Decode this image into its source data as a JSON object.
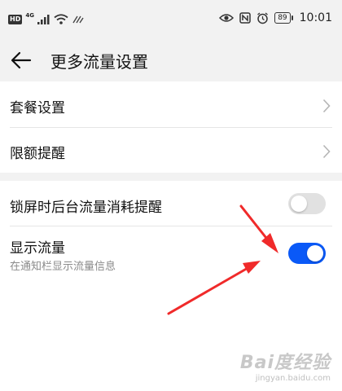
{
  "status_bar": {
    "hd_badge": "HD",
    "network_tag": "4G",
    "battery": "89",
    "time": "10:01",
    "icons": [
      "signal-icon",
      "wifi-icon",
      "eye-icon",
      "nfc-icon",
      "alarm-icon",
      "battery-icon"
    ]
  },
  "header": {
    "title": "更多流量设置",
    "back_icon": "arrow-left-icon"
  },
  "menu": {
    "items": [
      {
        "label": "套餐设置"
      },
      {
        "label": "限额提醒"
      }
    ]
  },
  "toggles": {
    "items": [
      {
        "label": "锁屏时后台流量消耗提醒",
        "sublabel": "",
        "state": "off"
      },
      {
        "label": "显示流量",
        "sublabel": "在通知栏显示流量信息",
        "state": "on"
      }
    ]
  },
  "colors": {
    "accent": "#0a59f7",
    "annotation_arrow": "#f02a2a",
    "background_gray": "#f2f2f2"
  },
  "watermark": {
    "logo": "Bai度经验",
    "url": "jingyan.baidu.com"
  }
}
